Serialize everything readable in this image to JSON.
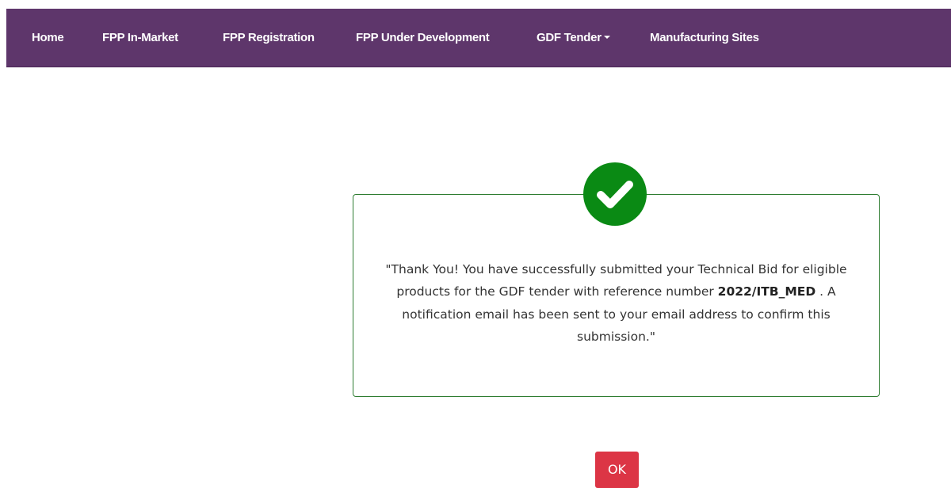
{
  "nav": {
    "items": [
      {
        "label": "Home"
      },
      {
        "label": "FPP In-Market"
      },
      {
        "label": "FPP Registration"
      },
      {
        "label": "FPP Under Development"
      },
      {
        "label": "GDF Tender",
        "has_dropdown": true
      },
      {
        "label": "Manufacturing Sites"
      }
    ],
    "background_color": "#5e366b"
  },
  "dialog": {
    "icon": "checkmark-circle-icon",
    "icon_color": "#0a8a14",
    "message_before": "\"Thank You! You have successfully submitted your Technical Bid for eligible products for the GDF tender with reference number ",
    "reference_number": "2022/ITB_MED",
    "message_after": " . A notification email has been sent to your email address to confirm this submission.\"",
    "border_color": "#2f7d32"
  },
  "ok_button": {
    "label": "OK",
    "color": "#dc3545"
  }
}
